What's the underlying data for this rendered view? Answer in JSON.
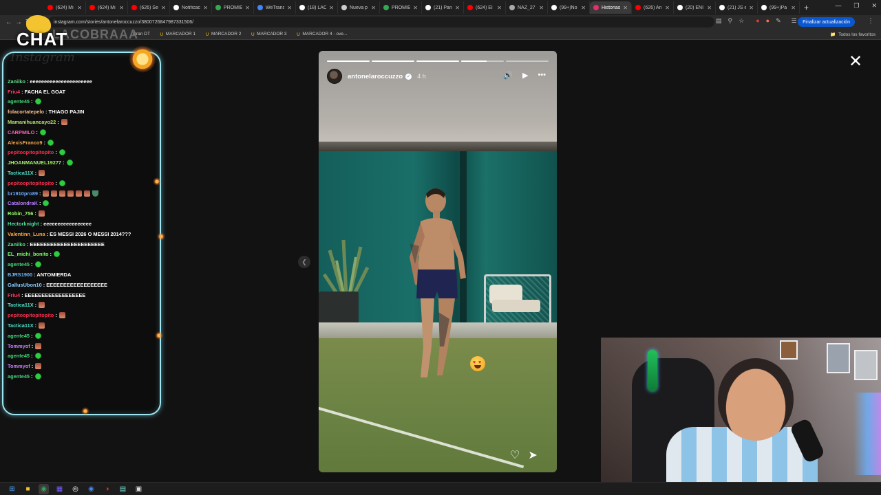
{
  "browser": {
    "tabs": [
      {
        "label": "(624) Mi",
        "color": "#ff0000"
      },
      {
        "label": "(624) Mi",
        "color": "#ff0000"
      },
      {
        "label": "(626) Se",
        "color": "#ff0000"
      },
      {
        "label": "Notificac",
        "color": "#ffffff"
      },
      {
        "label": "PROMIE",
        "color": "#34a853"
      },
      {
        "label": "WeTrans",
        "color": "#4285f4"
      },
      {
        "label": "(18) LAC",
        "color": "#ffffff"
      },
      {
        "label": "Nueva p",
        "color": "#cccccc"
      },
      {
        "label": "PROMIE",
        "color": "#34a853"
      },
      {
        "label": "(21) Pan",
        "color": "#ffffff"
      },
      {
        "label": "(624) El",
        "color": "#ff0000"
      },
      {
        "label": "NAZ_27",
        "color": "#aaaaaa"
      },
      {
        "label": "(99+)No",
        "color": "#ffffff"
      },
      {
        "label": "Historias",
        "color": "#e1306c",
        "active": true
      },
      {
        "label": "(626) An",
        "color": "#ff0000"
      },
      {
        "label": "(20) ENI",
        "color": "#ffffff"
      },
      {
        "label": "(21) JS e",
        "color": "#ffffff"
      },
      {
        "label": "(99+)Pa",
        "color": "#ffffff"
      }
    ],
    "url": "instagram.com/stories/antonelaroccuzzo/3800726847987331506/",
    "update_button": "Finalizar actualización",
    "bookmarks": [
      "Gran DT",
      "MARCADOR 1",
      "MARCADOR 2",
      "MARCADOR 3",
      "MARCADOR 4 - ove..."
    ],
    "all_favorites": "Todos los favoritos"
  },
  "story": {
    "username": "antonelaroccuzzo",
    "time": "4 h",
    "progress": [
      1.0,
      1.0,
      1.0,
      0.6,
      0.0
    ],
    "watermark": "Instagram"
  },
  "chat": {
    "title": "CHAT",
    "title_overlay": "LACOBRAAA",
    "messages": [
      {
        "user": "Zaniiko",
        "color": "#5fe08a",
        "text": ": eeeeeeeeeeeeeeeeeeeeee",
        "emotes": []
      },
      {
        "user": "Friu4",
        "color": "#ff3b5c",
        "text": ": FACHA EL GOAT",
        "emotes": []
      },
      {
        "user": "agente45",
        "color": "#3fd87a",
        "text": ":",
        "emotes": [
          "g"
        ]
      },
      {
        "user": "folacortatepelo",
        "color": "#ffc38a",
        "text": ": THIAGO PAJIN",
        "emotes": []
      },
      {
        "user": "Mamanihuancayo22",
        "color": "#b7e36b",
        "text": ":",
        "emotes": [
          "p"
        ]
      },
      {
        "user": "CARPMILO",
        "color": "#ff5fbf",
        "text": ":",
        "emotes": [
          "g"
        ]
      },
      {
        "user": "AlexisFranco9",
        "color": "#f7a74a",
        "text": ":",
        "emotes": [
          "g"
        ]
      },
      {
        "user": "pepitoopitopitopito",
        "color": "#ff2f4f",
        "text": ":",
        "emotes": [
          "g"
        ]
      },
      {
        "user": "JHOANMANUEL19277",
        "color": "#a3f06a",
        "text": ":",
        "emotes": [
          "g"
        ]
      },
      {
        "user": "Tactica11X",
        "color": "#4fe0c8",
        "text": ":",
        "emotes": [
          "p"
        ]
      },
      {
        "user": "pepitoopitopitopito",
        "color": "#ff2f4f",
        "text": ":",
        "emotes": [
          "g"
        ]
      },
      {
        "user": "br1910pro89",
        "color": "#6aa8ff",
        "text": ":",
        "emotes": [
          "p",
          "p",
          "p",
          "p",
          "p",
          "p",
          "s"
        ]
      },
      {
        "user": "CatalondraK",
        "color": "#b57bff",
        "text": ":",
        "emotes": [
          "g"
        ]
      },
      {
        "user": "Robin_756",
        "color": "#9aff6a",
        "text": ":",
        "emotes": [
          "p"
        ]
      },
      {
        "user": "Hectorknight",
        "color": "#4fe0a0",
        "text": ": eeeeeeeeeeeeeeeee",
        "emotes": []
      },
      {
        "user": "Valentinn_Luna",
        "color": "#ffa640",
        "text": ": ES MESSI 2026 O MESSI 2014???",
        "emotes": []
      },
      {
        "user": "Zaniiko",
        "color": "#5fe08a",
        "text": ": EEEEEEEEEEEEEEEEEEEEEE",
        "emotes": []
      },
      {
        "user": "EL_michi_bonito",
        "color": "#7dff6a",
        "text": ":",
        "emotes": [
          "g"
        ]
      },
      {
        "user": "agente45",
        "color": "#3fd87a",
        "text": ":",
        "emotes": [
          "g"
        ]
      },
      {
        "user": "BJRS1900",
        "color": "#6ab8ff",
        "text": ": ANTOMIERDA",
        "emotes": []
      },
      {
        "user": "GallusUbon10",
        "color": "#8fd0ff",
        "text": ": EEEEEEEEEEEEEEEEEE",
        "emotes": []
      },
      {
        "user": "Friu4",
        "color": "#ff3b5c",
        "text": ": EEEEEEEEEEEEEEEEEE",
        "emotes": []
      },
      {
        "user": "Tactica11X",
        "color": "#4fe0c8",
        "text": ":",
        "emotes": [
          "p"
        ]
      },
      {
        "user": "pepitoopitopitopito",
        "color": "#ff2f4f",
        "text": ":",
        "emotes": [
          "p"
        ]
      },
      {
        "user": "Tactica11X",
        "color": "#4fe0c8",
        "text": ":",
        "emotes": [
          "p"
        ]
      },
      {
        "user": "agente45",
        "color": "#3fd87a",
        "text": ":",
        "emotes": [
          "g"
        ]
      },
      {
        "user": "Tommyof",
        "color": "#c77dff",
        "text": ":",
        "emotes": [
          "p"
        ]
      },
      {
        "user": "agente45",
        "color": "#3fd87a",
        "text": ":",
        "emotes": [
          "g"
        ]
      },
      {
        "user": "Tommyof",
        "color": "#c77dff",
        "text": ":",
        "emotes": [
          "p"
        ]
      },
      {
        "user": "agente45",
        "color": "#3fd87a",
        "text": ":",
        "emotes": [
          "g"
        ]
      }
    ]
  },
  "taskbar": {
    "items": [
      "windows-start",
      "file-explorer",
      "chrome",
      "app-purple",
      "app-obs",
      "chrome-2",
      "app-capture",
      "app-notes",
      "app-terminal"
    ]
  },
  "colors": {
    "accent_blue": "#0b57d0",
    "chat_border": "#9fe6f0"
  }
}
